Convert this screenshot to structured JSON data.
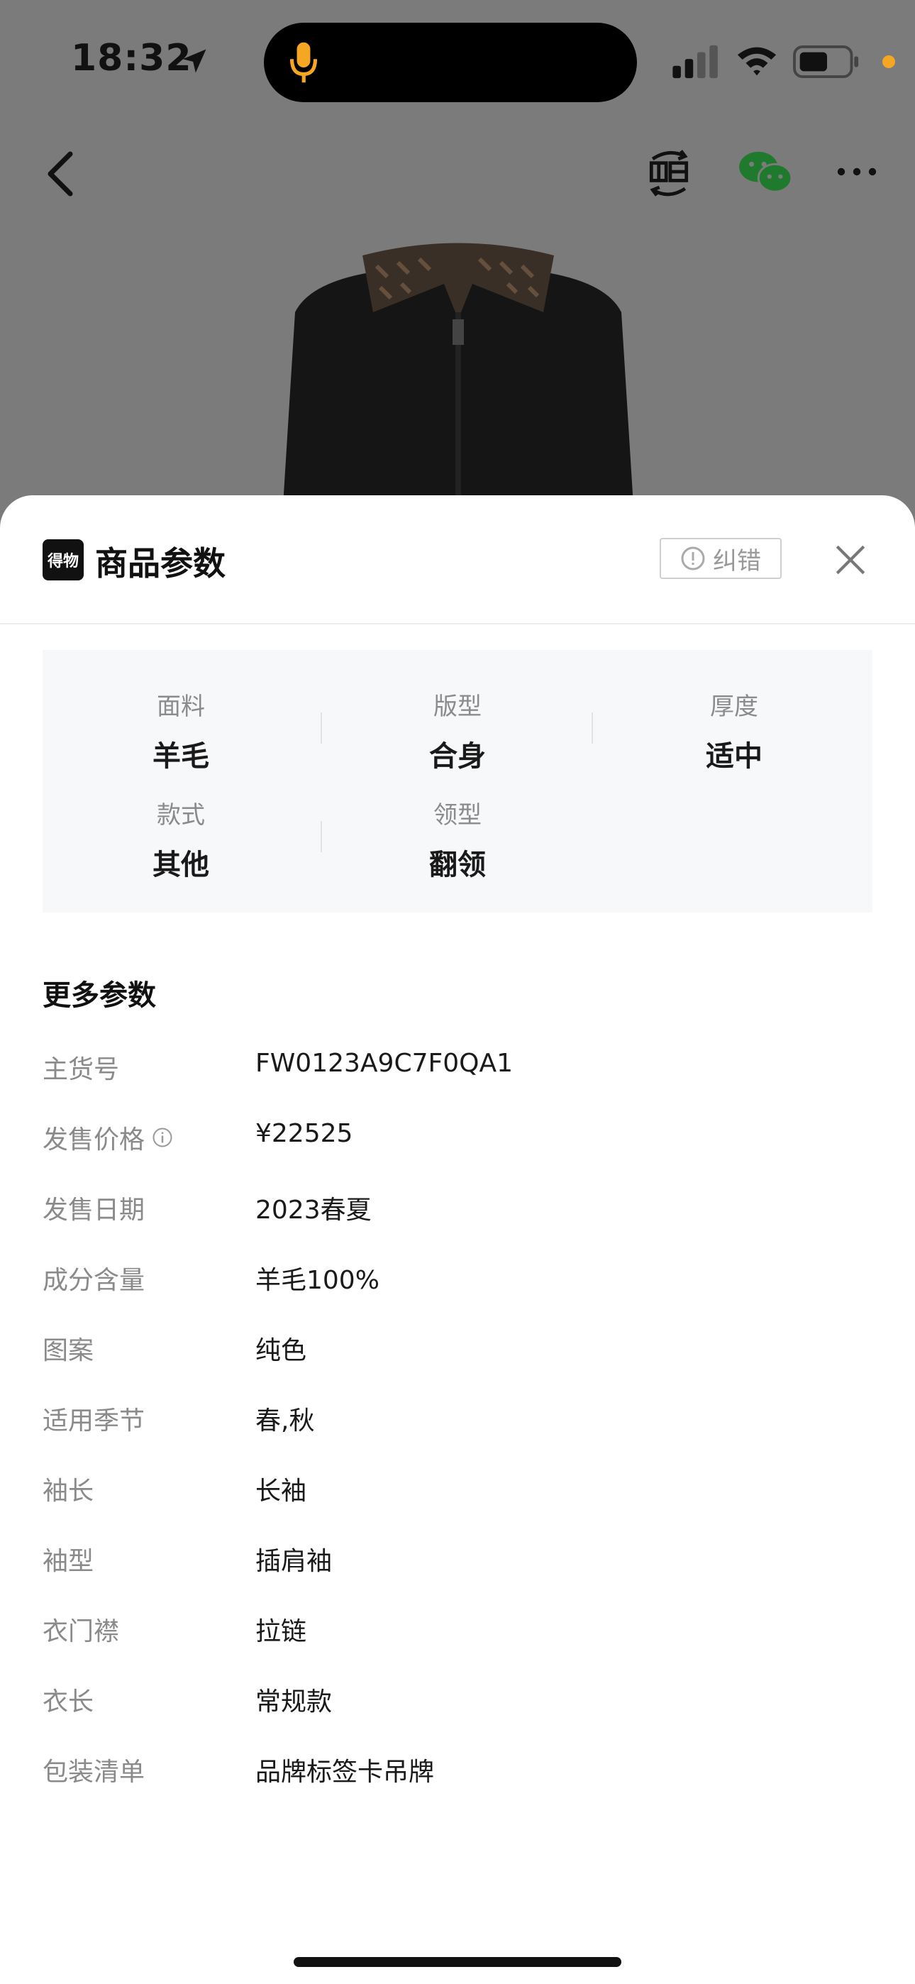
{
  "status_bar": {
    "time": "18:32"
  },
  "sheet": {
    "title": "商品参数",
    "brand_logo_text": "得物",
    "report_button": "纠错",
    "specs": [
      {
        "label": "面料",
        "value": "羊毛"
      },
      {
        "label": "版型",
        "value": "合身"
      },
      {
        "label": "厚度",
        "value": "适中"
      },
      {
        "label": "款式",
        "value": "其他"
      },
      {
        "label": "领型",
        "value": "翻领"
      }
    ],
    "more_title": "更多参数",
    "params": [
      {
        "label": "主货号",
        "value": "FW0123A9C7F0QA1"
      },
      {
        "label": "发售价格",
        "value": "¥22525"
      },
      {
        "label": "发售日期",
        "value": "2023春夏"
      },
      {
        "label": "成分含量",
        "value": "羊毛100%"
      },
      {
        "label": "图案",
        "value": "纯色"
      },
      {
        "label": "适用季节",
        "value": "春,秋"
      },
      {
        "label": "袖长",
        "value": "长袖"
      },
      {
        "label": "袖型",
        "value": "插肩袖"
      },
      {
        "label": "衣门襟",
        "value": "拉链"
      },
      {
        "label": "衣长",
        "value": "常规款"
      },
      {
        "label": "包装清单",
        "value": "品牌标签卡吊牌"
      }
    ]
  }
}
